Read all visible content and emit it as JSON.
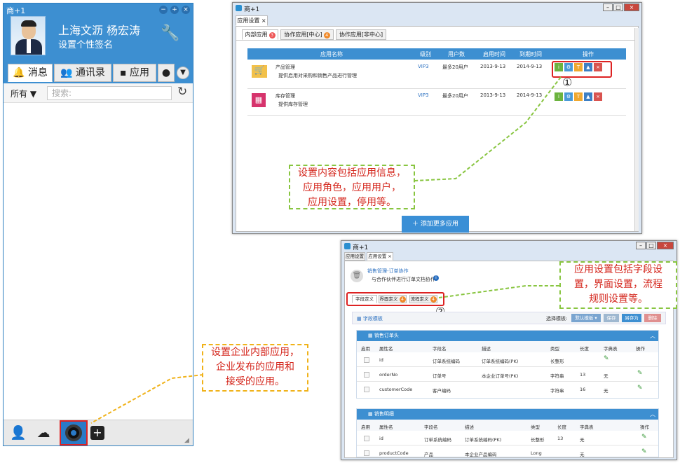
{
  "im": {
    "title": "商+1",
    "user_name": "上海文沥 杨宏涛",
    "signature": "设置个性签名",
    "tabs": [
      "消息",
      "通讯录",
      "应用"
    ],
    "filter_label": "所有",
    "search_placeholder": "搜索:"
  },
  "win1": {
    "title": "商+1",
    "tab": "应用设置",
    "subtabs": [
      {
        "label": "内部应用",
        "badge": "3"
      },
      {
        "label": "协作应用[中心]",
        "badge": "4"
      },
      {
        "label": "协作应用[非中心]",
        "badge": ""
      }
    ],
    "headers": [
      "应用名称",
      "级别",
      "用户数",
      "启用时间",
      "到期时间",
      "操作"
    ],
    "rows": [
      {
        "name": "产品管理",
        "desc": "提供启用对采购和销售产品进行管理",
        "level": "VIP3",
        "users": "最多20用户",
        "start": "2013-9-13",
        "end": "2014-9-13"
      },
      {
        "name": "库存管理",
        "desc": "提供库存管理",
        "level": "VIP3",
        "users": "最多20用户",
        "start": "2013-9-13",
        "end": "2014-9-13"
      }
    ],
    "add_button": "添加更多应用"
  },
  "win2": {
    "title": "商+1",
    "tabs": [
      "应用设置",
      "应用设置"
    ],
    "app_title": "销售管理-订单协作",
    "app_desc": "与合作伙伴进行订单文档协作",
    "subtabs": [
      {
        "label": "字段定义",
        "badge": ""
      },
      {
        "label": "界面定义",
        "badge": "4"
      },
      {
        "label": "流程定义",
        "badge": "4"
      }
    ],
    "template_label": "字段模板",
    "select_template": "选择模板:",
    "select_value": "默认模板",
    "btn_save": "保存",
    "btn_saveas": "另存为",
    "btn_delete": "删除",
    "section1": {
      "title": "销售订单头",
      "headers": [
        "启用",
        "属性名",
        "字段名",
        "描述",
        "类型",
        "长度",
        "字典表",
        "操作"
      ],
      "rows": [
        [
          "",
          "id",
          "订单系统编码",
          "订单系统编码(PK)",
          "长整形",
          "",
          "",
          ""
        ],
        [
          "",
          "orderNo",
          "订单号",
          "本企业订单号(PK)",
          "字符串",
          "13",
          "无",
          ""
        ],
        [
          "",
          "customerCode",
          "客户编码",
          "",
          "字符串",
          "16",
          "无",
          ""
        ]
      ]
    },
    "section2": {
      "title": "销售明细",
      "headers": [
        "启用",
        "属性名",
        "字段名",
        "描述",
        "类型",
        "长度",
        "字典表",
        "操作"
      ],
      "rows": [
        [
          "",
          "id",
          "订单系统编码",
          "订单系统编码(PK)",
          "长整形",
          "13",
          "无",
          ""
        ],
        [
          "",
          "productCode",
          "产品",
          "本企业产品编码",
          "Long",
          "",
          "无",
          ""
        ]
      ]
    }
  },
  "notes": {
    "note1": "设置内容包括应用信息，应用角色，应用用户，应用设置，停用等。",
    "note1_lines": [
      "设置内容包括应用信息，",
      "应用角色，应用用户，",
      "应用设置，停用等。"
    ],
    "note2_lines": [
      "应用设置包括字段设",
      "置，界面设置，流程",
      "规则设置等。"
    ],
    "note3_lines": [
      "设置企业内部应用，",
      "企业发布的应用和",
      "接受的应用。"
    ],
    "marker1": "①",
    "marker2": "②"
  }
}
